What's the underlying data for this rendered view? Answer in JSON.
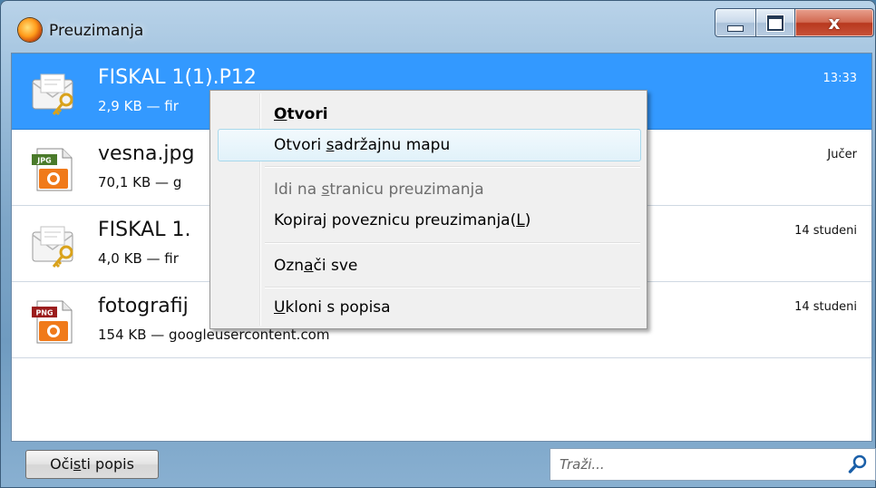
{
  "window": {
    "title": "Preuzimanja",
    "close_glyph": "x"
  },
  "downloads": [
    {
      "name": "FISKAL 1(1).P12",
      "meta": "2,9 KB — fir",
      "date": "13:33",
      "icon": "certificate-file-icon",
      "selected": true
    },
    {
      "name": "vesna.jpg",
      "meta": "70,1 KB — g",
      "date": "Jučer",
      "icon": "jpg-file-icon",
      "badge": "JPG",
      "selected": false
    },
    {
      "name": "FISKAL 1.",
      "meta": "4,0 KB — fir",
      "date": "14 studeni",
      "icon": "certificate-file-icon",
      "selected": false
    },
    {
      "name": "fotografij",
      "meta": "154 KB — googleusercontent.com",
      "date": "14 studeni",
      "icon": "png-file-icon",
      "badge": "PNG",
      "selected": false
    }
  ],
  "context_menu": {
    "open": {
      "pre": "",
      "key": "O",
      "post": "tvori"
    },
    "open_folder": {
      "pre": "Otvori ",
      "key": "s",
      "post": "adržajnu mapu"
    },
    "go_to_page": {
      "pre": "Idi na ",
      "key": "s",
      "post": "tranicu preuzimanja"
    },
    "copy_link": {
      "pre": "Kopiraj poveznicu preuzimanja(",
      "key": "L",
      "post": ")"
    },
    "select_all": {
      "pre": "Ozn",
      "key": "a",
      "post": "či sve"
    },
    "remove": {
      "pre": "",
      "key": "U",
      "post": "kloni s popisa"
    }
  },
  "bottom": {
    "clear": {
      "pre": "Oči",
      "key": "s",
      "post": "ti popis"
    },
    "search_placeholder": "Traži..."
  },
  "colors": {
    "selection": "#3399ff",
    "menu_background": "#f0f0f0",
    "jpg_badge": "#4a7a2a",
    "png_badge": "#9b1c1c",
    "icon_orange": "#f07a1a"
  }
}
